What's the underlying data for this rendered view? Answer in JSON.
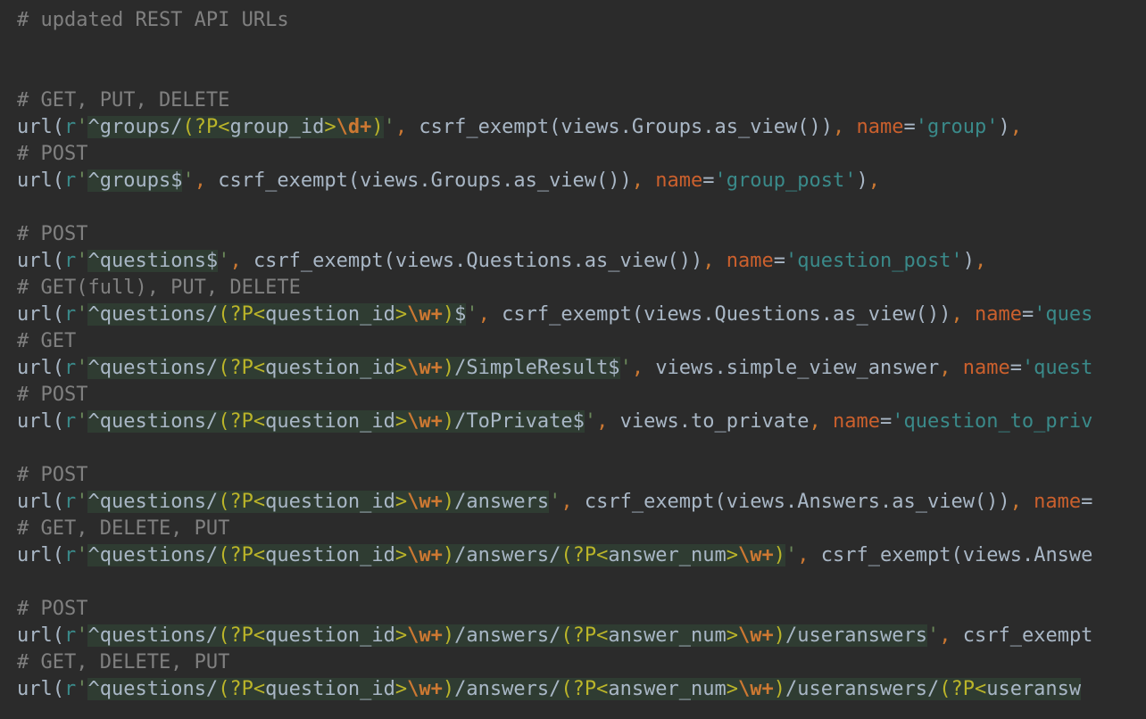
{
  "editor": {
    "language": "python",
    "theme": "dark",
    "colors": {
      "background": "#2b2b2b",
      "plain": "#a9b7c6",
      "comment": "#808080",
      "keyword_punct": "#cc7832",
      "string_quote": "#6a8759",
      "kwarg_name": "#cb602d",
      "string_value": "#3a8a8a",
      "regex_group": "#bbb529",
      "regex_escape": "#cc7832",
      "regex_background": "#2f3c32"
    },
    "lines": [
      [
        [
          "c",
          "# updated REST API URLs"
        ]
      ],
      [],
      [],
      [
        [
          "c",
          "# GET, PUT, DELETE"
        ]
      ],
      [
        [
          "p",
          "url("
        ],
        [
          "pre",
          "r"
        ],
        [
          "s",
          "'"
        ],
        [
          "r",
          "^groups/"
        ],
        [
          "rg",
          "(?P<"
        ],
        [
          "r",
          "group_id"
        ],
        [
          "rg",
          ">"
        ],
        [
          "re",
          "\\d+"
        ],
        [
          "rg",
          ")"
        ],
        [
          "s",
          "'"
        ],
        [
          "k",
          ", "
        ],
        [
          "p",
          "csrf_exempt(views.Groups.as_view())"
        ],
        [
          "k",
          ", "
        ],
        [
          "n",
          "name"
        ],
        [
          "p",
          "="
        ],
        [
          "sv",
          "'group'"
        ],
        [
          "p",
          ")"
        ],
        [
          "k",
          ","
        ]
      ],
      [
        [
          "c",
          "# POST"
        ]
      ],
      [
        [
          "p",
          "url("
        ],
        [
          "pre",
          "r"
        ],
        [
          "s",
          "'"
        ],
        [
          "r",
          "^groups$"
        ],
        [
          "s",
          "'"
        ],
        [
          "k",
          ", "
        ],
        [
          "p",
          "csrf_exempt(views.Groups.as_view())"
        ],
        [
          "k",
          ", "
        ],
        [
          "n",
          "name"
        ],
        [
          "p",
          "="
        ],
        [
          "sv",
          "'group_post'"
        ],
        [
          "p",
          ")"
        ],
        [
          "k",
          ","
        ]
      ],
      [],
      [
        [
          "c",
          "# POST"
        ]
      ],
      [
        [
          "p",
          "url("
        ],
        [
          "pre",
          "r"
        ],
        [
          "s",
          "'"
        ],
        [
          "r",
          "^questions$"
        ],
        [
          "s",
          "'"
        ],
        [
          "k",
          ", "
        ],
        [
          "p",
          "csrf_exempt(views.Questions.as_view())"
        ],
        [
          "k",
          ", "
        ],
        [
          "n",
          "name"
        ],
        [
          "p",
          "="
        ],
        [
          "sv",
          "'question_post'"
        ],
        [
          "p",
          ")"
        ],
        [
          "k",
          ","
        ]
      ],
      [
        [
          "c",
          "# GET(full), PUT, DELETE"
        ]
      ],
      [
        [
          "p",
          "url("
        ],
        [
          "pre",
          "r"
        ],
        [
          "s",
          "'"
        ],
        [
          "r",
          "^questions/"
        ],
        [
          "rg",
          "(?P<"
        ],
        [
          "r",
          "question_id"
        ],
        [
          "rg",
          ">"
        ],
        [
          "re",
          "\\w+"
        ],
        [
          "rg",
          ")"
        ],
        [
          "r",
          "$"
        ],
        [
          "s",
          "'"
        ],
        [
          "k",
          ", "
        ],
        [
          "p",
          "csrf_exempt(views.Questions.as_view())"
        ],
        [
          "k",
          ", "
        ],
        [
          "n",
          "name"
        ],
        [
          "p",
          "="
        ],
        [
          "sv",
          "'ques"
        ]
      ],
      [
        [
          "c",
          "# GET"
        ]
      ],
      [
        [
          "p",
          "url("
        ],
        [
          "pre",
          "r"
        ],
        [
          "s",
          "'"
        ],
        [
          "r",
          "^questions/"
        ],
        [
          "rg",
          "(?P<"
        ],
        [
          "r",
          "question_id"
        ],
        [
          "rg",
          ">"
        ],
        [
          "re",
          "\\w+"
        ],
        [
          "rg",
          ")"
        ],
        [
          "r",
          "/SimpleResult$"
        ],
        [
          "s",
          "'"
        ],
        [
          "k",
          ", "
        ],
        [
          "p",
          "views.simple_view_answer"
        ],
        [
          "k",
          ", "
        ],
        [
          "n",
          "name"
        ],
        [
          "p",
          "="
        ],
        [
          "sv",
          "'quest"
        ]
      ],
      [
        [
          "c",
          "# POST"
        ]
      ],
      [
        [
          "p",
          "url("
        ],
        [
          "pre",
          "r"
        ],
        [
          "s",
          "'"
        ],
        [
          "r",
          "^questions/"
        ],
        [
          "rg",
          "(?P<"
        ],
        [
          "r",
          "question_id"
        ],
        [
          "rg",
          ">"
        ],
        [
          "re",
          "\\w+"
        ],
        [
          "rg",
          ")"
        ],
        [
          "r",
          "/ToPrivate$"
        ],
        [
          "s",
          "'"
        ],
        [
          "k",
          ", "
        ],
        [
          "p",
          "views.to_private"
        ],
        [
          "k",
          ", "
        ],
        [
          "n",
          "name"
        ],
        [
          "p",
          "="
        ],
        [
          "sv",
          "'question_to_priv"
        ]
      ],
      [],
      [
        [
          "c",
          "# POST"
        ]
      ],
      [
        [
          "p",
          "url("
        ],
        [
          "pre",
          "r"
        ],
        [
          "s",
          "'"
        ],
        [
          "r",
          "^questions/"
        ],
        [
          "rg",
          "(?P<"
        ],
        [
          "r",
          "question_id"
        ],
        [
          "rg",
          ">"
        ],
        [
          "re",
          "\\w+"
        ],
        [
          "rg",
          ")"
        ],
        [
          "r",
          "/answers"
        ],
        [
          "s",
          "'"
        ],
        [
          "k",
          ", "
        ],
        [
          "p",
          "csrf_exempt(views.Answers.as_view())"
        ],
        [
          "k",
          ", "
        ],
        [
          "n",
          "name"
        ],
        [
          "p",
          "="
        ]
      ],
      [
        [
          "c",
          "# GET, DELETE, PUT"
        ]
      ],
      [
        [
          "p",
          "url("
        ],
        [
          "pre",
          "r"
        ],
        [
          "s",
          "'"
        ],
        [
          "r",
          "^questions/"
        ],
        [
          "rg",
          "(?P<"
        ],
        [
          "r",
          "question_id"
        ],
        [
          "rg",
          ">"
        ],
        [
          "re",
          "\\w+"
        ],
        [
          "rg",
          ")"
        ],
        [
          "r",
          "/answers/"
        ],
        [
          "rg",
          "(?P<"
        ],
        [
          "r",
          "answer_num"
        ],
        [
          "rg",
          ">"
        ],
        [
          "re",
          "\\w+"
        ],
        [
          "rg",
          ")"
        ],
        [
          "s",
          "'"
        ],
        [
          "k",
          ", "
        ],
        [
          "p",
          "csrf_exempt(views.Answe"
        ]
      ],
      [],
      [
        [
          "c",
          "# POST"
        ]
      ],
      [
        [
          "p",
          "url("
        ],
        [
          "pre",
          "r"
        ],
        [
          "s",
          "'"
        ],
        [
          "r",
          "^questions/"
        ],
        [
          "rg",
          "(?P<"
        ],
        [
          "r",
          "question_id"
        ],
        [
          "rg",
          ">"
        ],
        [
          "re",
          "\\w+"
        ],
        [
          "rg",
          ")"
        ],
        [
          "r",
          "/answers/"
        ],
        [
          "rg",
          "(?P<"
        ],
        [
          "r",
          "answer_num"
        ],
        [
          "rg",
          ">"
        ],
        [
          "re",
          "\\w+"
        ],
        [
          "rg",
          ")"
        ],
        [
          "r",
          "/useranswers"
        ],
        [
          "s",
          "'"
        ],
        [
          "k",
          ", "
        ],
        [
          "p",
          "csrf_exempt"
        ]
      ],
      [
        [
          "c",
          "# GET, DELETE, PUT"
        ]
      ],
      [
        [
          "p",
          "url("
        ],
        [
          "pre",
          "r"
        ],
        [
          "s",
          "'"
        ],
        [
          "r",
          "^questions/"
        ],
        [
          "rg",
          "(?P<"
        ],
        [
          "r",
          "question_id"
        ],
        [
          "rg",
          ">"
        ],
        [
          "re",
          "\\w+"
        ],
        [
          "rg",
          ")"
        ],
        [
          "r",
          "/answers/"
        ],
        [
          "rg",
          "(?P<"
        ],
        [
          "r",
          "answer_num"
        ],
        [
          "rg",
          ">"
        ],
        [
          "re",
          "\\w+"
        ],
        [
          "rg",
          ")"
        ],
        [
          "r",
          "/useranswers/"
        ],
        [
          "rg",
          "(?P<"
        ],
        [
          "r",
          "useransw"
        ]
      ]
    ]
  }
}
